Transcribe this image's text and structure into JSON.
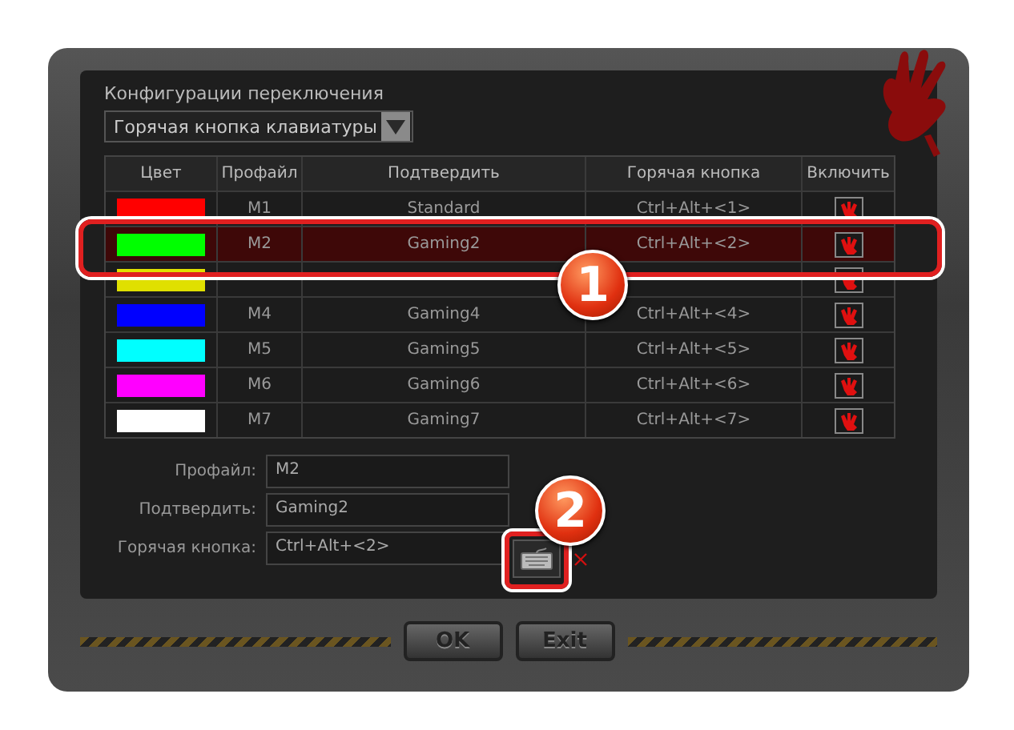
{
  "section_title": "Конфигурации переключения",
  "mode_dropdown": {
    "value": "Горячая кнопка клавиатуры"
  },
  "table": {
    "columns": [
      "Цвет",
      "Профайл",
      "Подтвердить",
      "Горячая кнопка",
      "Включить"
    ],
    "rows": [
      {
        "color": "#ff0000",
        "profile": "M1",
        "name": "Standard",
        "hotkey": "Ctrl+Alt+<1>",
        "selected": false
      },
      {
        "color": "#00ff00",
        "profile": "M2",
        "name": "Gaming2",
        "hotkey": "Ctrl+Alt+<2>",
        "selected": true
      },
      {
        "color": "#e0e000",
        "selected": false
      },
      {
        "color": "#0000ff",
        "profile": "M4",
        "name": "Gaming4",
        "hotkey": "Ctrl+Alt+<4>",
        "selected": false
      },
      {
        "color": "#00ffff",
        "profile": "M5",
        "name": "Gaming5",
        "hotkey": "Ctrl+Alt+<5>",
        "selected": false
      },
      {
        "color": "#ff00ff",
        "profile": "M6",
        "name": "Gaming6",
        "hotkey": "Ctrl+Alt+<6>",
        "selected": false
      },
      {
        "color": "#ffffff",
        "profile": "M7",
        "name": "Gaming7",
        "hotkey": "Ctrl+Alt+<7>",
        "selected": false
      }
    ]
  },
  "form": [
    {
      "label": "Профайл:",
      "value": "M2"
    },
    {
      "label": "Подтвердить:",
      "value": "Gaming2"
    },
    {
      "label": "Горячая кнопка:",
      "value": "Ctrl+Alt+<2>"
    }
  ],
  "buttons": [
    "OK",
    "Exit"
  ],
  "callouts": [
    "1",
    "2"
  ]
}
